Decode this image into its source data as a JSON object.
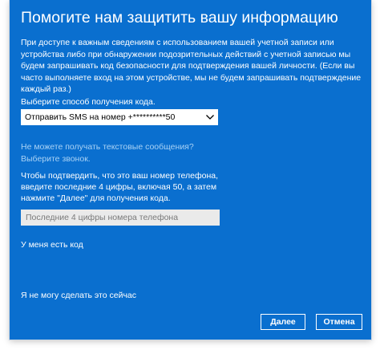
{
  "dialog": {
    "title": "Помогите нам защитить вашу информацию",
    "description": "При доступе к важным сведениям с использованием вашей учетной записи или устройства либо при обнаружении подозрительных действий с учетной записью мы будем запрашивать код безопасности для подтверждения вашей личности. (Если вы часто выполняете вход на этом устройстве, мы не будем запрашивать подтверждение каждый раз.)",
    "method_label": "Выберите способ получения кода.",
    "method_select": {
      "selected": "Отправить SMS на номер +**********50",
      "icon": "chevron-down-icon"
    },
    "no_sms_link": "Не можете получать текстовые сообщения? Выберите звонок.",
    "instruction": "Чтобы подтвердить, что это ваш номер телефона, введите последние 4 цифры, включая 50, а затем нажмите \"Далее\" для получения кода.",
    "digits_input": {
      "value": "",
      "placeholder": "Последние 4 цифры номера телефона"
    },
    "have_code_link": "У меня есть код",
    "cant_now_link": "Я не могу сделать это сейчас",
    "buttons": {
      "next": "Далее",
      "cancel": "Отмена"
    }
  },
  "colors": {
    "background": "#0a6fcf",
    "link": "#a9d2f5",
    "input_bg": "#eaeaea"
  }
}
